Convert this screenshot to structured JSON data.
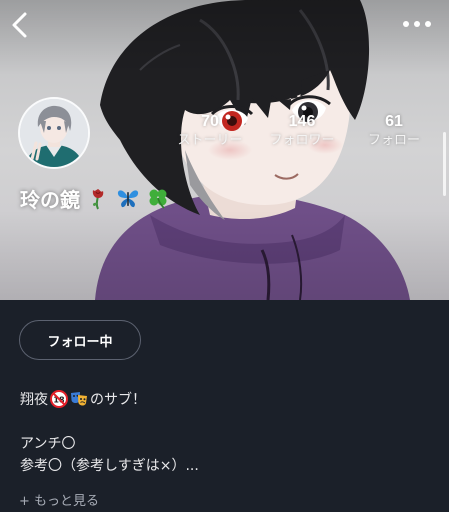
{
  "header": {
    "back_icon": "chevron-left-icon",
    "more_icon": "more-horizontal-icon"
  },
  "profile": {
    "username": "玲の鏡",
    "name_emojis": [
      "wilted-rose-icon",
      "butterfly-icon",
      "four-leaf-clover-icon"
    ]
  },
  "stats": [
    {
      "value": "70",
      "label": "ストーリー"
    },
    {
      "value": "146",
      "label": "フォロワー"
    },
    {
      "value": "61",
      "label": "フォロー"
    }
  ],
  "follow_button": {
    "label": "フォロー中"
  },
  "bio": {
    "line1_prefix": "翔夜",
    "line1_suffix": "のサブ！",
    "line1_emojis": [
      "no-under-18-icon",
      "performing-arts-icon"
    ],
    "line2": "アンチ〇",
    "line3": "参考〇（参考しすぎは×）..."
  },
  "more_link": {
    "label": "+ もっと見る"
  },
  "colors": {
    "panel_background": "#1b2029",
    "text_primary": "#ffffff",
    "text_secondary": "#a7acb6",
    "button_border": "#5c6270"
  }
}
